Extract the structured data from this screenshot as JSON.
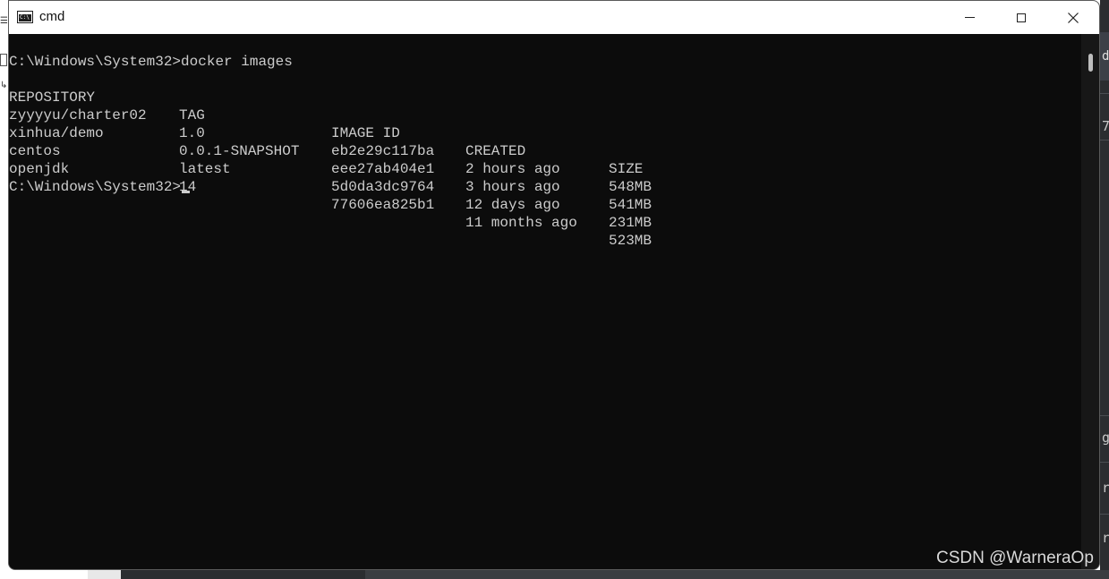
{
  "window": {
    "title": "cmd"
  },
  "console": {
    "command_line": "C:\\Windows\\System32>docker images",
    "headers": {
      "repository": "REPOSITORY",
      "tag": "TAG",
      "image_id": "IMAGE ID",
      "created": "CREATED",
      "size": "SIZE"
    },
    "rows": [
      {
        "repository": "zyyyyu/charter02",
        "tag": "1.0",
        "image_id": "eb2e29c117ba",
        "created": "2 hours ago",
        "size": "548MB"
      },
      {
        "repository": "xinhua/demo",
        "tag": "0.0.1-SNAPSHOT",
        "image_id": "eee27ab404e1",
        "created": "3 hours ago",
        "size": "541MB"
      },
      {
        "repository": "centos",
        "tag": "latest",
        "image_id": "5d0da3dc9764",
        "created": "12 days ago",
        "size": "231MB"
      },
      {
        "repository": "openjdk",
        "tag": "14",
        "image_id": "77606ea825b1",
        "created": "11 months ago",
        "size": "523MB"
      }
    ],
    "prompt": "C:\\Windows\\System32>"
  },
  "background": {
    "right_chars": [
      "d",
      "7",
      "g",
      "r",
      "r"
    ]
  },
  "watermark": "CSDN @WarneraOp",
  "colors": {
    "console_bg": "#0c0c0c",
    "console_text": "#cccccc",
    "titlebar_bg": "#ffffff"
  },
  "icons": {
    "window_icon": "console-icon",
    "minimize": "minimize-icon",
    "maximize": "maximize-icon",
    "close": "close-icon"
  }
}
